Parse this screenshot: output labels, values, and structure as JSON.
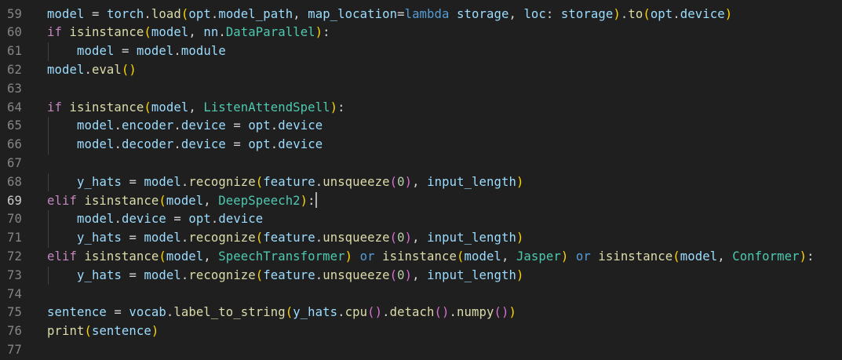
{
  "editor": {
    "background": "#1f1f1f",
    "active_line": "69",
    "line_numbers": [
      "59",
      "60",
      "61",
      "62",
      "63",
      "64",
      "65",
      "66",
      "67",
      "68",
      "69",
      "70",
      "71",
      "72",
      "73",
      "74",
      "75",
      "76",
      "77"
    ],
    "lines": [
      "model = torch.load(opt.model_path, map_location=lambda storage, loc: storage).to(opt.device)",
      "if isinstance(model, nn.DataParallel):",
      "    model = model.module",
      "model.eval()",
      "",
      "if isinstance(model, ListenAttendSpell):",
      "    model.encoder.device = opt.device",
      "    model.decoder.device = opt.device",
      "",
      "    y_hats = model.recognize(feature.unsqueeze(0), input_length)",
      "elif isinstance(model, DeepSpeech2):",
      "    model.device = opt.device",
      "    y_hats = model.recognize(feature.unsqueeze(0), input_length)",
      "elif isinstance(model, SpeechTransformer) or isinstance(model, Jasper) or isinstance(model, Conformer):",
      "    y_hats = model.recognize(feature.unsqueeze(0), input_length)",
      "",
      "sentence = vocab.label_to_string(y_hats.cpu().detach().numpy())",
      "print(sentence)",
      ""
    ]
  },
  "colors": {
    "variable": "#9cdcfe",
    "function": "#dcdcaa",
    "class": "#4ec9b0",
    "control_keyword": "#c586c0",
    "keyword": "#569cd6",
    "number": "#b5cea8",
    "bracket_1": "#ffd700",
    "bracket_2": "#da70d6",
    "bracket_3": "#179fff",
    "line_number": "#858585"
  }
}
